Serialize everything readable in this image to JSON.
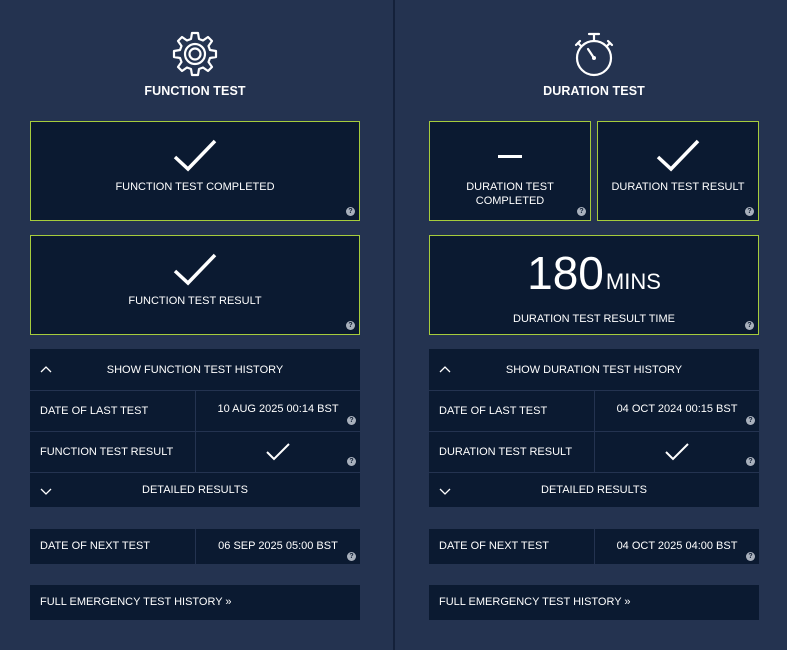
{
  "function": {
    "title": "FUNCTION TEST",
    "completed_label": "FUNCTION TEST COMPLETED",
    "result_label": "FUNCTION TEST RESULT",
    "history_toggle": "SHOW FUNCTION TEST HISTORY",
    "last_test_label": "DATE OF LAST TEST",
    "last_test_value": "10 AUG 2025 00:14 BST",
    "result_row_label": "FUNCTION TEST RESULT",
    "detailed_label": "DETAILED RESULTS",
    "next_test_label": "DATE OF NEXT TEST",
    "next_test_value": "06 SEP 2025 05:00 BST",
    "full_history_link": "FULL EMERGENCY TEST HISTORY »"
  },
  "duration": {
    "title": "DURATION TEST",
    "completed_label": "DURATION TEST COMPLETED",
    "result_label": "DURATION TEST RESULT",
    "result_time_value": "180",
    "result_time_unit": "MINS",
    "result_time_label": "DURATION TEST RESULT TIME",
    "history_toggle": "SHOW DURATION TEST HISTORY",
    "last_test_label": "DATE OF LAST TEST",
    "last_test_value": "04 OCT 2024 00:15 BST",
    "result_row_label": "DURATION TEST RESULT",
    "detailed_label": "DETAILED RESULTS",
    "next_test_label": "DATE OF NEXT TEST",
    "next_test_value": "04 OCT 2025 04:00 BST",
    "full_history_link": "FULL EMERGENCY TEST HISTORY »"
  },
  "help_glyph": "?",
  "colors": {
    "background": "#243350",
    "panel": "#0b1a31",
    "accent_border": "#a6cc3c",
    "text": "#ffffff"
  },
  "icons": {
    "function_header": "gear-icon",
    "duration_header": "stopwatch-icon",
    "pass": "checkmark-icon",
    "pending": "dash-icon",
    "help": "help-icon",
    "collapse": "chevron-up-icon",
    "expand": "chevron-down-icon"
  }
}
